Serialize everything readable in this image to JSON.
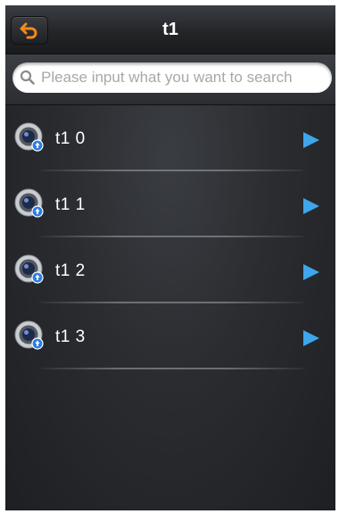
{
  "header": {
    "title": "t1",
    "back_icon": "back-arrow-icon",
    "accent_color": "#f08a1c"
  },
  "search": {
    "placeholder": "Please input what you want to search",
    "value": "",
    "icon": "search-icon"
  },
  "list": {
    "items": [
      {
        "label": "t1 0",
        "icon": "camera-icon",
        "chevron": "play-arrow-icon"
      },
      {
        "label": "t1 1",
        "icon": "camera-icon",
        "chevron": "play-arrow-icon"
      },
      {
        "label": "t1 2",
        "icon": "camera-icon",
        "chevron": "play-arrow-icon"
      },
      {
        "label": "t1 3",
        "icon": "camera-icon",
        "chevron": "play-arrow-icon"
      }
    ],
    "arrow_color": "#3ea6ea"
  }
}
